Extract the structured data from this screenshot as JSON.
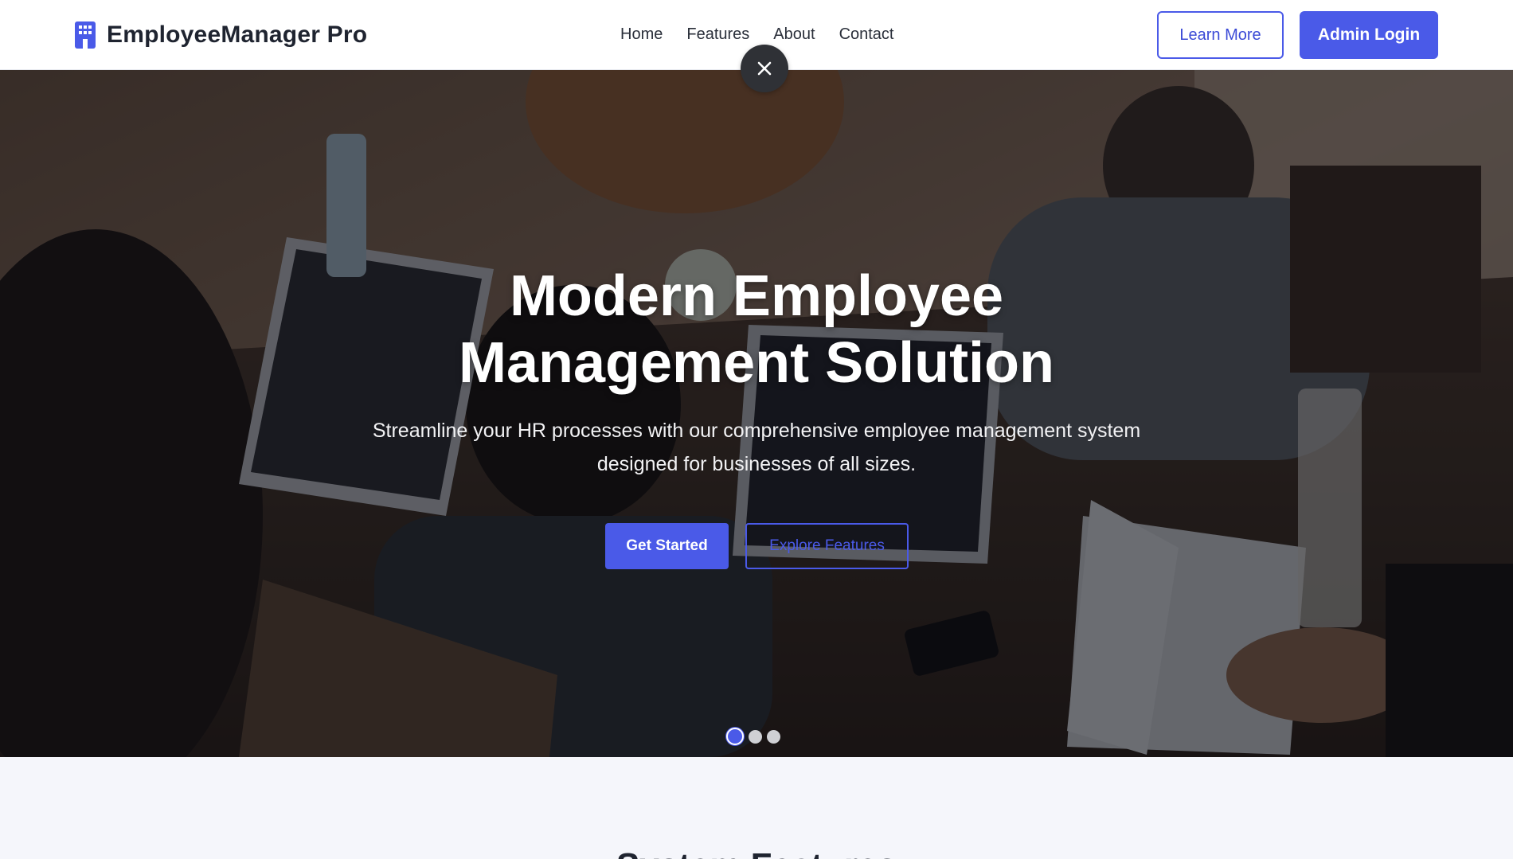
{
  "app": {
    "brand_name": "EmployeeManager Pro",
    "accent_color": "#4a5ae8"
  },
  "nav": {
    "links": [
      {
        "label": "Home"
      },
      {
        "label": "Features"
      },
      {
        "label": "About"
      },
      {
        "label": "Contact"
      }
    ],
    "learn_more_label": "Learn More",
    "admin_login_label": "Admin Login"
  },
  "overlay": {
    "close_icon": "close-icon"
  },
  "hero": {
    "title_line1": "Modern Employee",
    "title_line2": "Management Solution",
    "subtitle_line1": "Streamline your HR processes with our comprehensive employee management system",
    "subtitle_line2": "designed for businesses of all sizes.",
    "get_started_label": "Get Started",
    "explore_features_label": "Explore Features",
    "carousel": {
      "slide_count": 3,
      "active_slide": 1
    }
  },
  "next_section": {
    "heading": "System Features"
  }
}
